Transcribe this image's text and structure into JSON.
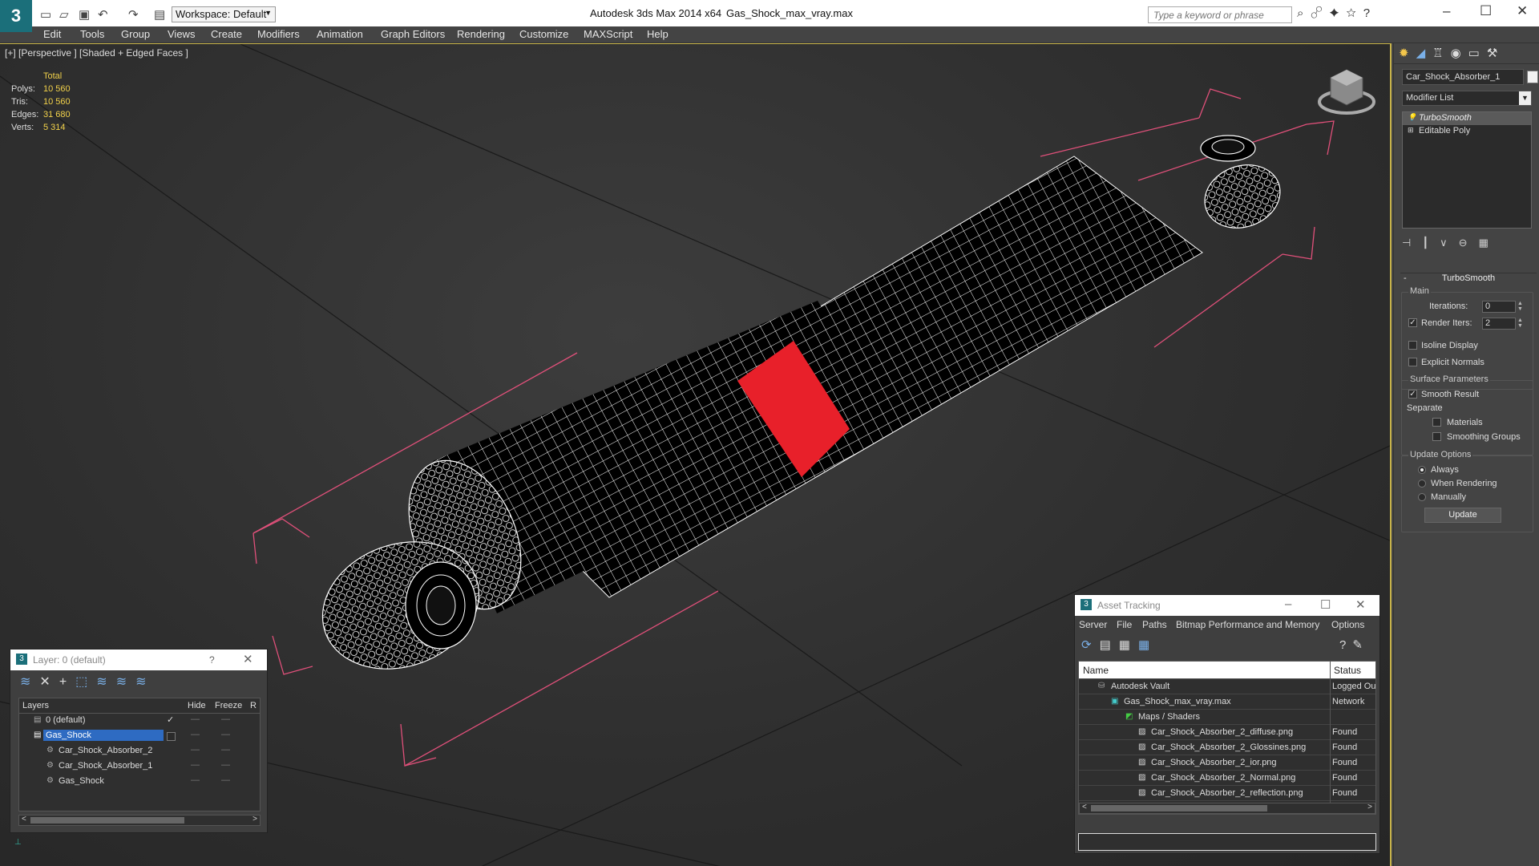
{
  "app": {
    "logo": "3",
    "title": "Autodesk 3ds Max  2014 x64",
    "file": "Gas_Shock_max_vray.max",
    "workspace": "Workspace: Default",
    "search_placeholder": "Type a keyword or phrase"
  },
  "icons": {
    "quick_access": [
      "new-file-icon",
      "open-icon",
      "save-icon",
      "undo-icon",
      "redo-icon",
      "project-icon"
    ],
    "window_controls": {
      "minimize": "–",
      "maximize": "☐",
      "close": "✕"
    }
  },
  "menu": [
    "Edit",
    "Tools",
    "Group",
    "Views",
    "Create",
    "Modifiers",
    "Animation",
    "Graph Editors",
    "Rendering",
    "Customize",
    "MAXScript",
    "Help"
  ],
  "viewport": {
    "label": "[+] [Perspective ] [Shaded + Edged Faces ]",
    "stats_header": "Total",
    "stats": [
      {
        "label": "Polys:",
        "value": "10 560"
      },
      {
        "label": "Tris:",
        "value": "10 560"
      },
      {
        "label": "Edges:",
        "value": "31 680"
      },
      {
        "label": "Verts:",
        "value": "5 314"
      }
    ],
    "colors": {
      "wire": "#ffffff",
      "body": "#000000",
      "label": "#e8202a",
      "bbox": "#e0507a"
    }
  },
  "cmdpanel": {
    "object_name": "Car_Shock_Absorber_1",
    "modifier_list": "Modifier List",
    "stack": [
      "TurboSmooth",
      "Editable Poly"
    ],
    "rollout": "TurboSmooth",
    "main_group": "Main",
    "iterations_label": "Iterations:",
    "iterations": "0",
    "render_iters_label": "Render Iters:",
    "render_iters": "2",
    "isoline": "Isoline Display",
    "explicit_normals": "Explicit Normals",
    "surface_group": "Surface Parameters",
    "smooth_result": "Smooth Result",
    "separate": "Separate",
    "materials": "Materials",
    "smoothing_groups": "Smoothing Groups",
    "update_group": "Update Options",
    "always": "Always",
    "when_rendering": "When Rendering",
    "manually": "Manually",
    "update_btn": "Update"
  },
  "layer_dialog": {
    "title": "Layer: 0 (default)",
    "help": "?",
    "cols": {
      "layers": "Layers",
      "hide": "Hide",
      "freeze": "Freeze",
      "r": "R"
    },
    "rows": [
      {
        "name": "0 (default)",
        "indent": 1,
        "check": "✓"
      },
      {
        "name": "Gas_Shock",
        "indent": 1,
        "check": ""
      },
      {
        "name": "Car_Shock_Absorber_2",
        "indent": 2,
        "check": ""
      },
      {
        "name": "Car_Shock_Absorber_1",
        "indent": 2,
        "check": ""
      },
      {
        "name": "Gas_Shock",
        "indent": 2,
        "check": ""
      }
    ]
  },
  "asset_tracking": {
    "title": "Asset Tracking",
    "menu": [
      "Server",
      "File",
      "Paths",
      "Bitmap Performance and Memory",
      "Options"
    ],
    "cols": {
      "name": "Name",
      "status": "Status"
    },
    "rows": [
      {
        "name": "Autodesk Vault",
        "status": "Logged Out",
        "indent": 1
      },
      {
        "name": "Gas_Shock_max_vray.max",
        "status": "Network",
        "indent": 2
      },
      {
        "name": "Maps / Shaders",
        "status": "",
        "indent": 3
      },
      {
        "name": "Car_Shock_Absorber_2_diffuse.png",
        "status": "Found",
        "indent": 4
      },
      {
        "name": "Car_Shock_Absorber_2_Glossines.png",
        "status": "Found",
        "indent": 4
      },
      {
        "name": "Car_Shock_Absorber_2_ior.png",
        "status": "Found",
        "indent": 4
      },
      {
        "name": "Car_Shock_Absorber_2_Normal.png",
        "status": "Found",
        "indent": 4
      },
      {
        "name": "Car_Shock_Absorber_2_reflection.png",
        "status": "Found",
        "indent": 4
      }
    ]
  }
}
